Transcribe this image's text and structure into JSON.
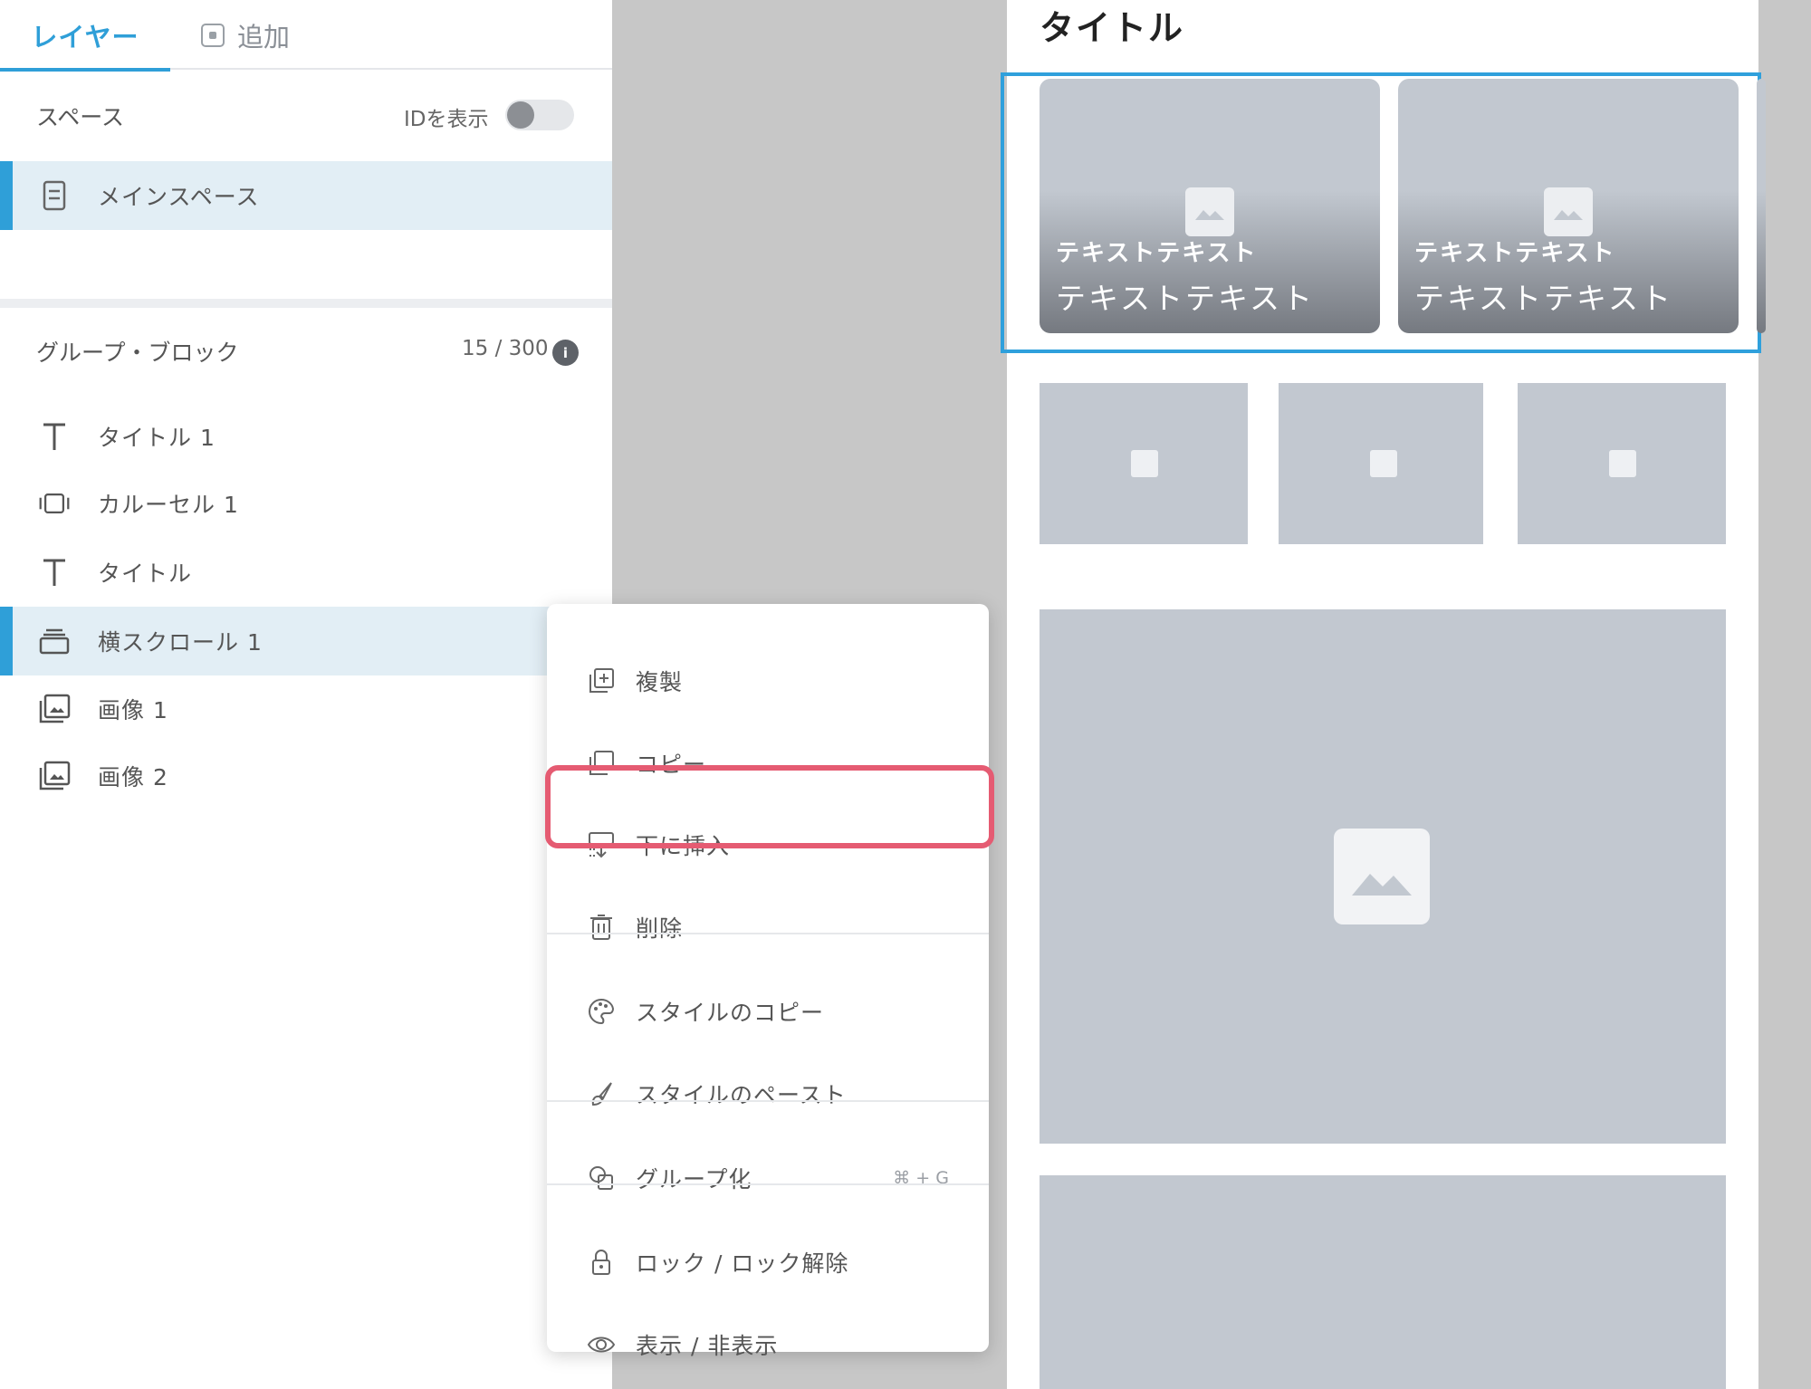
{
  "tabs": {
    "layers": "レイヤー",
    "add": "追加"
  },
  "space": {
    "label": "スペース",
    "show_id_label": "IDを表示",
    "show_id_enabled": false,
    "main_space": "メインスペース"
  },
  "group": {
    "label": "グループ・ブロック",
    "count": "15 / 300",
    "info_glyph": "i"
  },
  "layers": [
    {
      "label": "タイトル 1",
      "icon": "text-icon"
    },
    {
      "label": "カルーセル 1",
      "icon": "carousel-icon"
    },
    {
      "label": "タイトル",
      "icon": "text-icon"
    },
    {
      "label": "横スクロール 1",
      "icon": "horizontal-scroll-icon",
      "selected": true
    },
    {
      "label": "画像 1",
      "icon": "image-stack-icon"
    },
    {
      "label": "画像 2",
      "icon": "image-stack-icon"
    }
  ],
  "context_menu": {
    "items": [
      {
        "label": "複製",
        "icon": "duplicate-icon"
      },
      {
        "label": "コピー",
        "icon": "copy-icon"
      },
      {
        "label": "下に挿入",
        "icon": "insert-below-icon",
        "highlighted": true
      },
      {
        "label": "削除",
        "icon": "trash-icon"
      },
      {
        "label": "スタイルのコピー",
        "icon": "palette-icon"
      },
      {
        "label": "スタイルのペースト",
        "icon": "brush-icon"
      },
      {
        "label": "グループ化",
        "icon": "group-icon",
        "shortcut": "⌘ + G"
      },
      {
        "label": "ロック / ロック解除",
        "icon": "lock-icon"
      },
      {
        "label": "表示 / 非表示",
        "icon": "eye-icon"
      }
    ]
  },
  "preview": {
    "title": "タイトル",
    "cards": [
      {
        "line1": "テキストテキスト",
        "line2": "テキストテキスト"
      },
      {
        "line1": "テキストテキスト",
        "line2": "テキストテキスト"
      }
    ]
  },
  "colors": {
    "accent": "#2f9fd8",
    "highlight": "#e55b72",
    "placeholder": "#c2c8d0",
    "canvas": "#c7c7c7"
  }
}
